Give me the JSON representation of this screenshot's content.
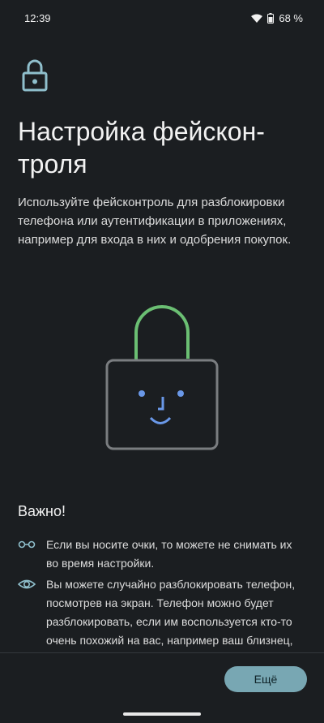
{
  "status_bar": {
    "time": "12:39",
    "battery_percent": "68 %",
    "icons": [
      "wifi-icon",
      "battery-icon"
    ]
  },
  "header": {
    "icon": "lock-icon",
    "title": "Настройка фейскон-\nтроля"
  },
  "description": "Используйте фейсконтроль для разблокировки телефона или аутентификации в приложениях, например для входа в них и одобрения покупок.",
  "illustration": {
    "icon": "face-unlock-illustration",
    "shackle_color": "#6bbf73",
    "face_color": "#6a98e8"
  },
  "important": {
    "title": "Важно!",
    "tips": [
      {
        "icon": "glasses-icon",
        "text": "Если вы носите очки, то можете не снимать их во время настройки."
      },
      {
        "icon": "eye-icon",
        "text": "Вы можете случайно разблокировать телефон, посмотрев на экран. Телефон можно будет разблокировать, если им воспользуется кто-то очень похожий на вас, например ваш близнец,"
      }
    ]
  },
  "footer": {
    "more_label": "Ещё"
  },
  "colors": {
    "background": "#1b1e21",
    "accent": "#78a7b3"
  }
}
